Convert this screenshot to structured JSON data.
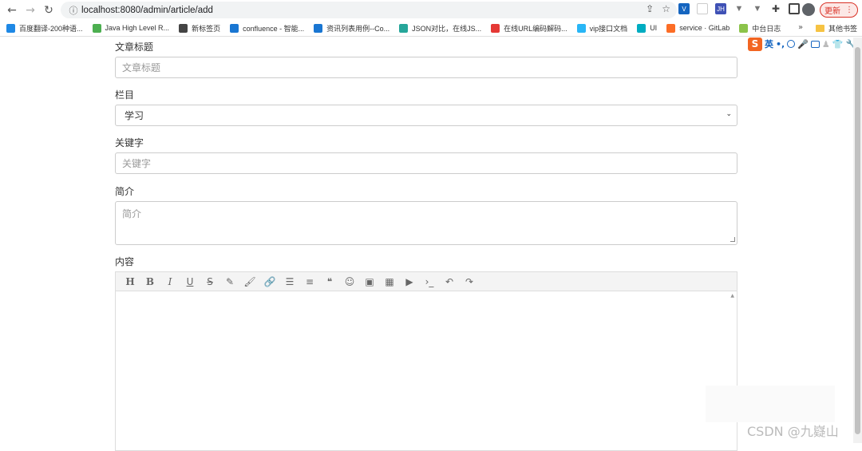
{
  "browser": {
    "url": "localhost:8080/admin/article/add",
    "update_label": "更新",
    "extensions": [
      "twin-logo-icon",
      "blank-page-icon",
      "jh-icon",
      "v-icon",
      "v-icon-2",
      "puzzle-icon",
      "sidepanel-icon"
    ]
  },
  "bookmarks": [
    {
      "label": "百度翻译-200种语...",
      "color": "#1e88e5"
    },
    {
      "label": "Java High Level R...",
      "color": "#4caf50"
    },
    {
      "label": "新标签页",
      "color": "#444444"
    },
    {
      "label": "confluence - 智能...",
      "color": "#1976d2"
    },
    {
      "label": "资讯列表用例--Co...",
      "color": "#1976d2"
    },
    {
      "label": "JSON对比，在线JS...",
      "color": "#26a69a"
    },
    {
      "label": "在线URL编码解码...",
      "color": "#e53935"
    },
    {
      "label": "vip接口文档",
      "color": "#29b6f6"
    },
    {
      "label": "UI",
      "color": "#00acc1"
    },
    {
      "label": "service · GitLab",
      "color": "#fc6d26"
    },
    {
      "label": "中台日志",
      "color": "#8bc34a"
    }
  ],
  "bookmarks_more": "»",
  "bookmarks_other": "其他书签",
  "ime": {
    "logo": "S",
    "mode": "英"
  },
  "form": {
    "title_label": "文章标题",
    "title_placeholder": "文章标题",
    "column_label": "栏目",
    "column_value": "学习",
    "keyword_label": "关键字",
    "keyword_placeholder": "关键字",
    "summary_label": "简介",
    "summary_placeholder": "简介",
    "content_label": "内容"
  },
  "editor_toolbar": [
    {
      "name": "heading-icon",
      "glyph": "H"
    },
    {
      "name": "bold-icon",
      "glyph": "B"
    },
    {
      "name": "italic-icon",
      "glyph": "I"
    },
    {
      "name": "underline-icon",
      "glyph": "U"
    },
    {
      "name": "strikethrough-icon",
      "glyph": "S"
    },
    {
      "name": "highlighter-icon",
      "glyph": "✎"
    },
    {
      "name": "brush-icon",
      "glyph": "🖌"
    },
    {
      "name": "link-icon",
      "glyph": "🔗"
    },
    {
      "name": "list-icon",
      "glyph": "☰"
    },
    {
      "name": "align-icon",
      "glyph": "≡"
    },
    {
      "name": "quote-icon",
      "glyph": "❝"
    },
    {
      "name": "emoji-icon",
      "glyph": "☺"
    },
    {
      "name": "image-icon",
      "glyph": "▣"
    },
    {
      "name": "table-icon",
      "glyph": "▦"
    },
    {
      "name": "video-icon",
      "glyph": "▶"
    },
    {
      "name": "code-icon",
      "glyph": "›_"
    },
    {
      "name": "undo-icon",
      "glyph": "↶"
    },
    {
      "name": "redo-icon",
      "glyph": "↷"
    }
  ],
  "watermark": "CSDN @九嶷山"
}
